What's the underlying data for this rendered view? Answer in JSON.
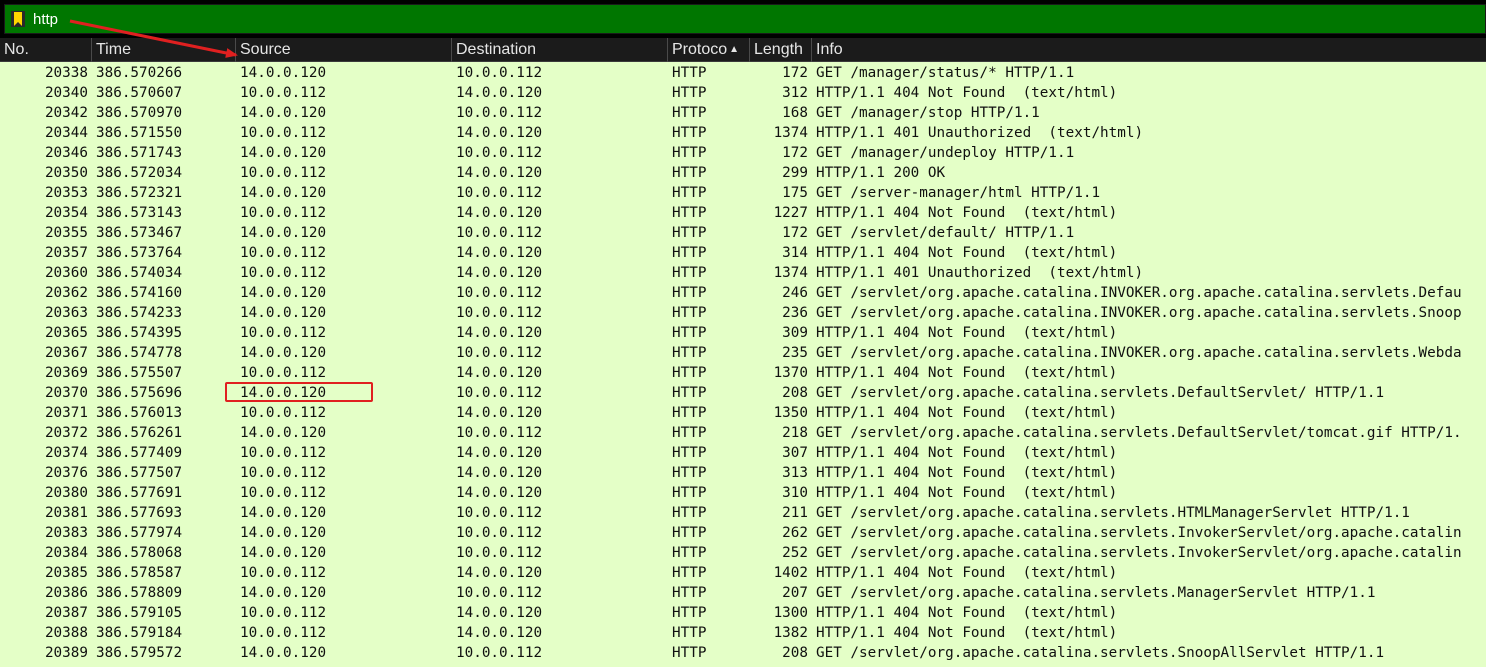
{
  "filter": {
    "value": "http",
    "placeholder": ""
  },
  "columns": {
    "no": "No.",
    "time": "Time",
    "source": "Source",
    "destination": "Destination",
    "protocol": "Protoco",
    "length": "Length",
    "info": "Info"
  },
  "colors": {
    "row_bg": "#e4ffc7",
    "filter_bg": "#007600",
    "header_bg": "#1b1b1b",
    "annotation": "#e02020",
    "bookmark": "#ffd700"
  },
  "icons": {
    "bookmark": "bookmark-icon",
    "sort": "sort-ascending-icon",
    "arrow": "annotation-arrow"
  },
  "packets": [
    {
      "no": "20338",
      "time": "386.570266",
      "src": "14.0.0.120",
      "dst": "10.0.0.112",
      "proto": "HTTP",
      "len": "172",
      "info": "GET /manager/status/* HTTP/1.1"
    },
    {
      "no": "20340",
      "time": "386.570607",
      "src": "10.0.0.112",
      "dst": "14.0.0.120",
      "proto": "HTTP",
      "len": "312",
      "info": "HTTP/1.1 404 Not Found  (text/html)"
    },
    {
      "no": "20342",
      "time": "386.570970",
      "src": "14.0.0.120",
      "dst": "10.0.0.112",
      "proto": "HTTP",
      "len": "168",
      "info": "GET /manager/stop HTTP/1.1"
    },
    {
      "no": "20344",
      "time": "386.571550",
      "src": "10.0.0.112",
      "dst": "14.0.0.120",
      "proto": "HTTP",
      "len": "1374",
      "info": "HTTP/1.1 401 Unauthorized  (text/html)"
    },
    {
      "no": "20346",
      "time": "386.571743",
      "src": "14.0.0.120",
      "dst": "10.0.0.112",
      "proto": "HTTP",
      "len": "172",
      "info": "GET /manager/undeploy HTTP/1.1"
    },
    {
      "no": "20350",
      "time": "386.572034",
      "src": "10.0.0.112",
      "dst": "14.0.0.120",
      "proto": "HTTP",
      "len": "299",
      "info": "HTTP/1.1 200 OK"
    },
    {
      "no": "20353",
      "time": "386.572321",
      "src": "14.0.0.120",
      "dst": "10.0.0.112",
      "proto": "HTTP",
      "len": "175",
      "info": "GET /server-manager/html HTTP/1.1"
    },
    {
      "no": "20354",
      "time": "386.573143",
      "src": "10.0.0.112",
      "dst": "14.0.0.120",
      "proto": "HTTP",
      "len": "1227",
      "info": "HTTP/1.1 404 Not Found  (text/html)"
    },
    {
      "no": "20355",
      "time": "386.573467",
      "src": "14.0.0.120",
      "dst": "10.0.0.112",
      "proto": "HTTP",
      "len": "172",
      "info": "GET /servlet/default/ HTTP/1.1"
    },
    {
      "no": "20357",
      "time": "386.573764",
      "src": "10.0.0.112",
      "dst": "14.0.0.120",
      "proto": "HTTP",
      "len": "314",
      "info": "HTTP/1.1 404 Not Found  (text/html)"
    },
    {
      "no": "20360",
      "time": "386.574034",
      "src": "10.0.0.112",
      "dst": "14.0.0.120",
      "proto": "HTTP",
      "len": "1374",
      "info": "HTTP/1.1 401 Unauthorized  (text/html)"
    },
    {
      "no": "20362",
      "time": "386.574160",
      "src": "14.0.0.120",
      "dst": "10.0.0.112",
      "proto": "HTTP",
      "len": "246",
      "info": "GET /servlet/org.apache.catalina.INVOKER.org.apache.catalina.servlets.Defau"
    },
    {
      "no": "20363",
      "time": "386.574233",
      "src": "14.0.0.120",
      "dst": "10.0.0.112",
      "proto": "HTTP",
      "len": "236",
      "info": "GET /servlet/org.apache.catalina.INVOKER.org.apache.catalina.servlets.Snoop"
    },
    {
      "no": "20365",
      "time": "386.574395",
      "src": "10.0.0.112",
      "dst": "14.0.0.120",
      "proto": "HTTP",
      "len": "309",
      "info": "HTTP/1.1 404 Not Found  (text/html)"
    },
    {
      "no": "20367",
      "time": "386.574778",
      "src": "14.0.0.120",
      "dst": "10.0.0.112",
      "proto": "HTTP",
      "len": "235",
      "info": "GET /servlet/org.apache.catalina.INVOKER.org.apache.catalina.servlets.Webda"
    },
    {
      "no": "20369",
      "time": "386.575507",
      "src": "10.0.0.112",
      "dst": "14.0.0.120",
      "proto": "HTTP",
      "len": "1370",
      "info": "HTTP/1.1 404 Not Found  (text/html)"
    },
    {
      "no": "20370",
      "time": "386.575696",
      "src": "14.0.0.120",
      "dst": "10.0.0.112",
      "proto": "HTTP",
      "len": "208",
      "info": "GET /servlet/org.apache.catalina.servlets.DefaultServlet/ HTTP/1.1"
    },
    {
      "no": "20371",
      "time": "386.576013",
      "src": "10.0.0.112",
      "dst": "14.0.0.120",
      "proto": "HTTP",
      "len": "1350",
      "info": "HTTP/1.1 404 Not Found  (text/html)"
    },
    {
      "no": "20372",
      "time": "386.576261",
      "src": "14.0.0.120",
      "dst": "10.0.0.112",
      "proto": "HTTP",
      "len": "218",
      "info": "GET /servlet/org.apache.catalina.servlets.DefaultServlet/tomcat.gif HTTP/1."
    },
    {
      "no": "20374",
      "time": "386.577409",
      "src": "10.0.0.112",
      "dst": "14.0.0.120",
      "proto": "HTTP",
      "len": "307",
      "info": "HTTP/1.1 404 Not Found  (text/html)"
    },
    {
      "no": "20376",
      "time": "386.577507",
      "src": "10.0.0.112",
      "dst": "14.0.0.120",
      "proto": "HTTP",
      "len": "313",
      "info": "HTTP/1.1 404 Not Found  (text/html)"
    },
    {
      "no": "20380",
      "time": "386.577691",
      "src": "10.0.0.112",
      "dst": "14.0.0.120",
      "proto": "HTTP",
      "len": "310",
      "info": "HTTP/1.1 404 Not Found  (text/html)"
    },
    {
      "no": "20381",
      "time": "386.577693",
      "src": "14.0.0.120",
      "dst": "10.0.0.112",
      "proto": "HTTP",
      "len": "211",
      "info": "GET /servlet/org.apache.catalina.servlets.HTMLManagerServlet HTTP/1.1"
    },
    {
      "no": "20383",
      "time": "386.577974",
      "src": "14.0.0.120",
      "dst": "10.0.0.112",
      "proto": "HTTP",
      "len": "262",
      "info": "GET /servlet/org.apache.catalina.servlets.InvokerServlet/org.apache.catalin"
    },
    {
      "no": "20384",
      "time": "386.578068",
      "src": "14.0.0.120",
      "dst": "10.0.0.112",
      "proto": "HTTP",
      "len": "252",
      "info": "GET /servlet/org.apache.catalina.servlets.InvokerServlet/org.apache.catalin"
    },
    {
      "no": "20385",
      "time": "386.578587",
      "src": "10.0.0.112",
      "dst": "14.0.0.120",
      "proto": "HTTP",
      "len": "1402",
      "info": "HTTP/1.1 404 Not Found  (text/html)"
    },
    {
      "no": "20386",
      "time": "386.578809",
      "src": "14.0.0.120",
      "dst": "10.0.0.112",
      "proto": "HTTP",
      "len": "207",
      "info": "GET /servlet/org.apache.catalina.servlets.ManagerServlet HTTP/1.1"
    },
    {
      "no": "20387",
      "time": "386.579105",
      "src": "10.0.0.112",
      "dst": "14.0.0.120",
      "proto": "HTTP",
      "len": "1300",
      "info": "HTTP/1.1 404 Not Found  (text/html)"
    },
    {
      "no": "20388",
      "time": "386.579184",
      "src": "10.0.0.112",
      "dst": "14.0.0.120",
      "proto": "HTTP",
      "len": "1382",
      "info": "HTTP/1.1 404 Not Found  (text/html)"
    },
    {
      "no": "20389",
      "time": "386.579572",
      "src": "14.0.0.120",
      "dst": "10.0.0.112",
      "proto": "HTTP",
      "len": "208",
      "info": "GET /servlet/org.apache.catalina.servlets.SnoopAllServlet HTTP/1.1"
    }
  ]
}
